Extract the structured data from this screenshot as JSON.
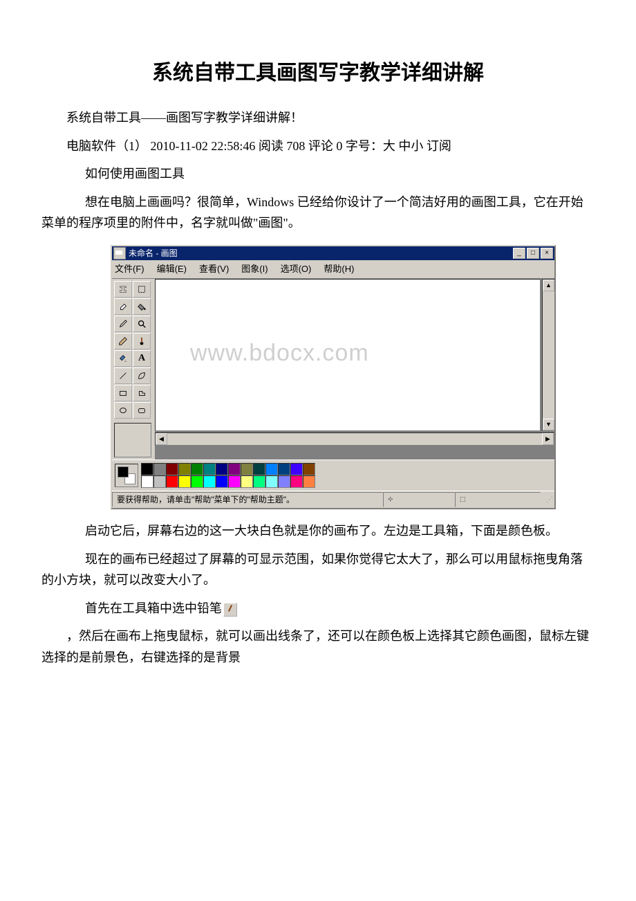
{
  "title": "系统自带工具画图写字教学详细讲解",
  "p1": "系统自带工具——画图写字教学详细讲解！",
  "p2_pre": "电脑软件（1） 2010-11-02 22:58:46 阅读 708 评论 0   字号：大 中小 订阅",
  "p3": "如何使用画图工具",
  "p4": "想在电脑上画画吗？很简单，Windows 已经给你设计了一个简洁好用的画图工具，它在开始菜单的程序项里的附件中，名字就叫做\"画图\"。",
  "screenshot": {
    "title": "未命名 - 画图",
    "menu": [
      "文件(F)",
      "编辑(E)",
      "查看(V)",
      "图象(I)",
      "选项(O)",
      "帮助(H)"
    ],
    "watermark": "www.bdocx.com",
    "status": "要获得帮助，请单击\"帮助\"菜单下的\"帮助主题\"。",
    "palette_row1": [
      "#000000",
      "#808080",
      "#800000",
      "#808000",
      "#008000",
      "#008080",
      "#000080",
      "#800080",
      "#808040",
      "#004040",
      "#0080ff",
      "#004080",
      "#4000ff",
      "#804000"
    ],
    "palette_row2": [
      "#ffffff",
      "#c0c0c0",
      "#ff0000",
      "#ffff00",
      "#00ff00",
      "#00ffff",
      "#0000ff",
      "#ff00ff",
      "#ffff80",
      "#00ff80",
      "#80ffff",
      "#8080ff",
      "#ff0080",
      "#ff8040"
    ]
  },
  "p5": "启动它后，屏幕右边的这一大块白色就是你的画布了。左边是工具箱，下面是颜色板。",
  "p6": "现在的画布已经超过了屏幕的可显示范围，如果你觉得它太大了，那么可以用鼠标拖曳角落的小方块，就可以改变大小了。",
  "p7": "首先在工具箱中选中铅笔",
  "p8": "，然后在画布上拖曳鼠标，就可以画出线条了，还可以在颜色板上选择其它颜色画图，鼠标左键选择的是前景色，右键选择的是背景"
}
